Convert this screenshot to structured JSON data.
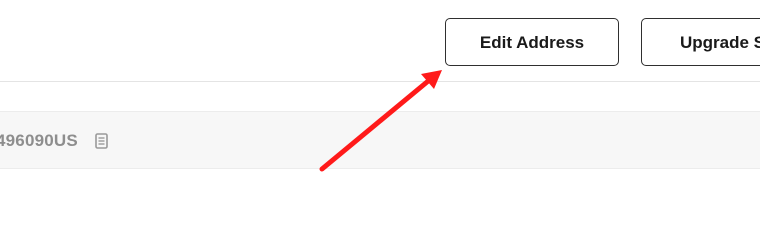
{
  "header": {
    "edit_address_label": "Edit Address",
    "upgrade_label": "Upgrade S"
  },
  "tracking": {
    "id_text": "496090US",
    "copy_icon": "copy-icon"
  },
  "annotation": {
    "arrow_color": "#ff1a1a"
  }
}
